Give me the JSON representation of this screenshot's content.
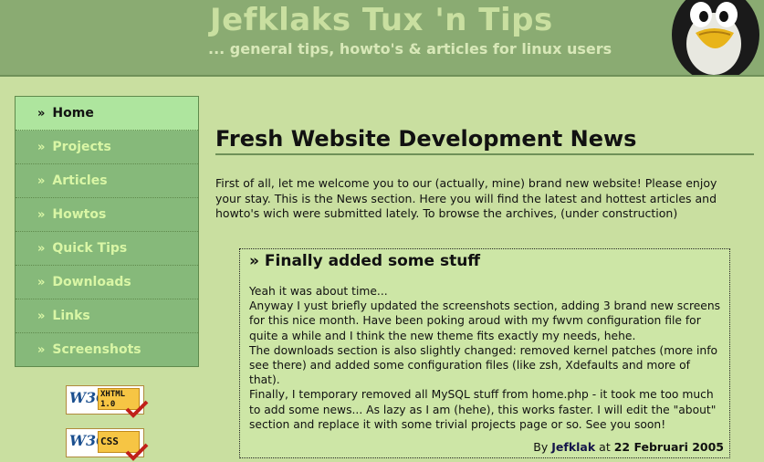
{
  "header": {
    "title": "Jefklaks Tux 'n Tips",
    "tagline": "... general tips, howto's & articles for linux users",
    "logo_icon": "tux-penguin-icon"
  },
  "nav": {
    "items": [
      {
        "label": "Home",
        "active": true
      },
      {
        "label": "Projects"
      },
      {
        "label": "Articles"
      },
      {
        "label": "Howtos"
      },
      {
        "label": "Quick Tips"
      },
      {
        "label": "Downloads"
      },
      {
        "label": "Links"
      },
      {
        "label": "Screenshots"
      }
    ],
    "bullet": "»"
  },
  "badges": [
    {
      "org": "W3C",
      "label_line1": "XHTML",
      "label_line2": "1.0"
    },
    {
      "org": "W3C",
      "label_line1": "CSS",
      "label_line2": ""
    }
  ],
  "main": {
    "title": "Fresh Website Development News",
    "intro": "First of all, let me welcome you to our (actually, mine) brand new website! Please enjoy your stay. This is the News section. Here you will find the latest and hottest articles and howto's wich were submitted lately. To browse the archives, (under construction)"
  },
  "news": {
    "title": "» Finally added some stuff",
    "lines": [
      "Yeah it was about time...",
      "Anyway I yust briefly updated the screenshots section, adding 3 brand new screens for this nice month. Have been poking aroud with my fwvm configuration file for quite a while and I think the new theme fits exactly my needs, hehe.",
      "The downloads section is also slightly changed: removed kernel patches (more info see there) and added some configuration files (like zsh, Xdefaults and more of that).",
      "Finally, I temporary removed all MySQL stuff from home.php - it took me too much to add some news... As lazy as I am (hehe), this works faster. I will edit the \"about\" section and replace it with some trivial projects page or so. See you soon!"
    ],
    "by": "By",
    "author": "Jefklak",
    "at": "at",
    "date": "22 Februari 2005"
  },
  "colors": {
    "background": "#c9dfa0",
    "header": "#8aab72",
    "nav": "#86b97a",
    "nav_active": "#aee59e",
    "nav_text": "#d9f6a5"
  }
}
